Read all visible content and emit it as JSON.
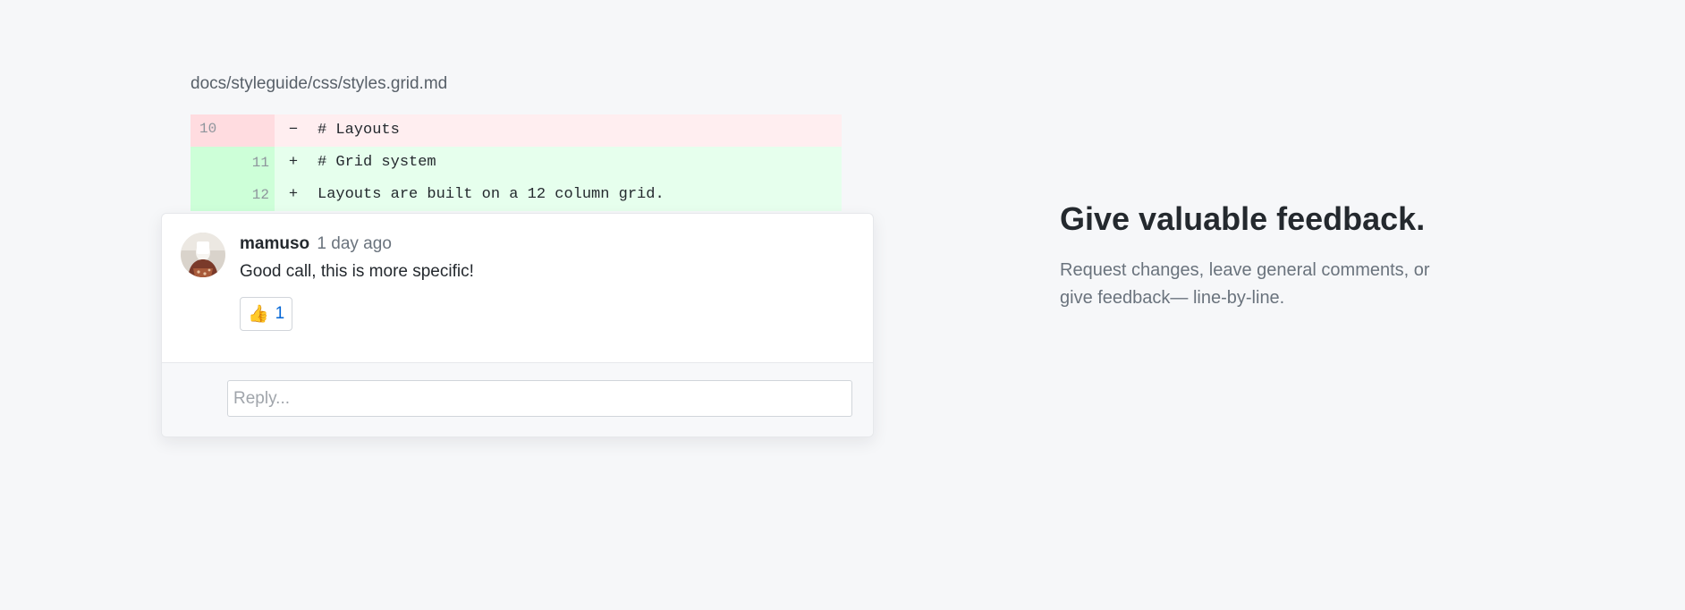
{
  "file_path": "docs/styleguide/css/styles.grid.md",
  "diff": {
    "rows": [
      {
        "type": "del",
        "num": "10",
        "sign": "−",
        "code": "# Layouts"
      },
      {
        "type": "add",
        "num": "11",
        "sign": "+",
        "code": "# Grid system"
      },
      {
        "type": "add",
        "num": "12",
        "sign": "+",
        "code": "Layouts are built on a 12 column grid."
      }
    ]
  },
  "comment": {
    "author": "mamuso",
    "timestamp": "1 day ago",
    "text": "Good call, this is more specific!",
    "reaction": {
      "emoji": "👍",
      "count": "1",
      "icon": "thumbs-up-icon"
    }
  },
  "reply": {
    "placeholder": "Reply..."
  },
  "feature": {
    "headline": "Give valuable feedback.",
    "description": "Request changes, leave general comments, or give feedback— line-by-line."
  },
  "colors": {
    "background": "#f6f7f9",
    "deletion_row": "#ffeef0",
    "addition_row": "#e6ffed",
    "link_blue": "#0366d6"
  }
}
